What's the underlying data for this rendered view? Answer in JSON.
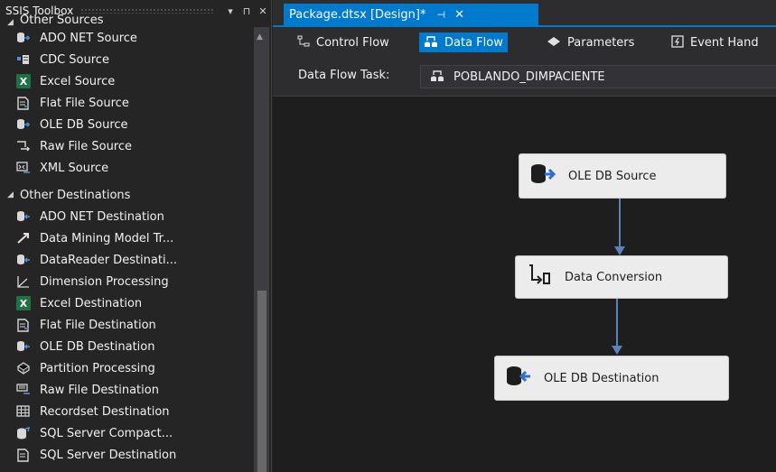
{
  "toolbox": {
    "title": "SSIS Toolbox",
    "pin_glyph": "▾",
    "dock_glyph": "⊓",
    "close_glyph": "✕",
    "other_sources": {
      "label": "Other Sources",
      "items": [
        {
          "label": "ADO NET Source",
          "icon": "db-arrow-icon"
        },
        {
          "label": "CDC Source",
          "icon": "cdc-icon"
        },
        {
          "label": "Excel Source",
          "icon": "excel-icon"
        },
        {
          "label": "Flat File Source",
          "icon": "flat-file-icon"
        },
        {
          "label": "OLE DB Source",
          "icon": "db-arrow-icon"
        },
        {
          "label": "Raw File Source",
          "icon": "raw-file-icon"
        },
        {
          "label": "XML Source",
          "icon": "xml-icon"
        }
      ]
    },
    "other_destinations": {
      "label": "Other Destinations",
      "items": [
        {
          "label": "ADO NET Destination",
          "icon": "db-arrow-in-icon"
        },
        {
          "label": "Data Mining Model Tr...",
          "icon": "mining-icon"
        },
        {
          "label": "DataReader Destinati...",
          "icon": "db-arrow-in-icon"
        },
        {
          "label": "Dimension Processing",
          "icon": "dimension-icon"
        },
        {
          "label": "Excel Destination",
          "icon": "excel-icon"
        },
        {
          "label": "Flat File Destination",
          "icon": "flat-file-icon"
        },
        {
          "label": "OLE DB Destination",
          "icon": "db-arrow-in-icon"
        },
        {
          "label": "Partition Processing",
          "icon": "partition-icon"
        },
        {
          "label": "Raw File Destination",
          "icon": "raw-file-icon"
        },
        {
          "label": "Recordset Destination",
          "icon": "recordset-icon"
        },
        {
          "label": "SQL Server Compact...",
          "icon": "sql-compact-icon"
        },
        {
          "label": "SQL Server Destination",
          "icon": "sql-server-icon"
        }
      ]
    }
  },
  "document_tab": {
    "title": "Package.dtsx [Design]*",
    "pin_glyph": "⊣",
    "close_glyph": "✕"
  },
  "designer_tabs": [
    {
      "label": "Control Flow",
      "icon": "control-flow-icon"
    },
    {
      "label": "Data Flow",
      "icon": "data-flow-icon"
    },
    {
      "label": "Parameters",
      "icon": "parameters-icon"
    },
    {
      "label": "Event Hand",
      "icon": "event-handlers-icon"
    }
  ],
  "task_bar": {
    "label": "Data Flow Task:",
    "value": "POBLANDO_DIMPACIENTE"
  },
  "canvas": {
    "nodes": [
      {
        "label": "OLE DB Source",
        "icon": "ole-db-source-icon"
      },
      {
        "label": "Data Conversion",
        "icon": "data-conversion-icon"
      },
      {
        "label": "OLE DB Destination",
        "icon": "ole-db-destination-icon"
      }
    ]
  },
  "colors": {
    "accent": "#007acc",
    "background": "#252526",
    "canvas": "#1e1e1e",
    "node": "#ececec",
    "connector": "#5b82b8"
  }
}
